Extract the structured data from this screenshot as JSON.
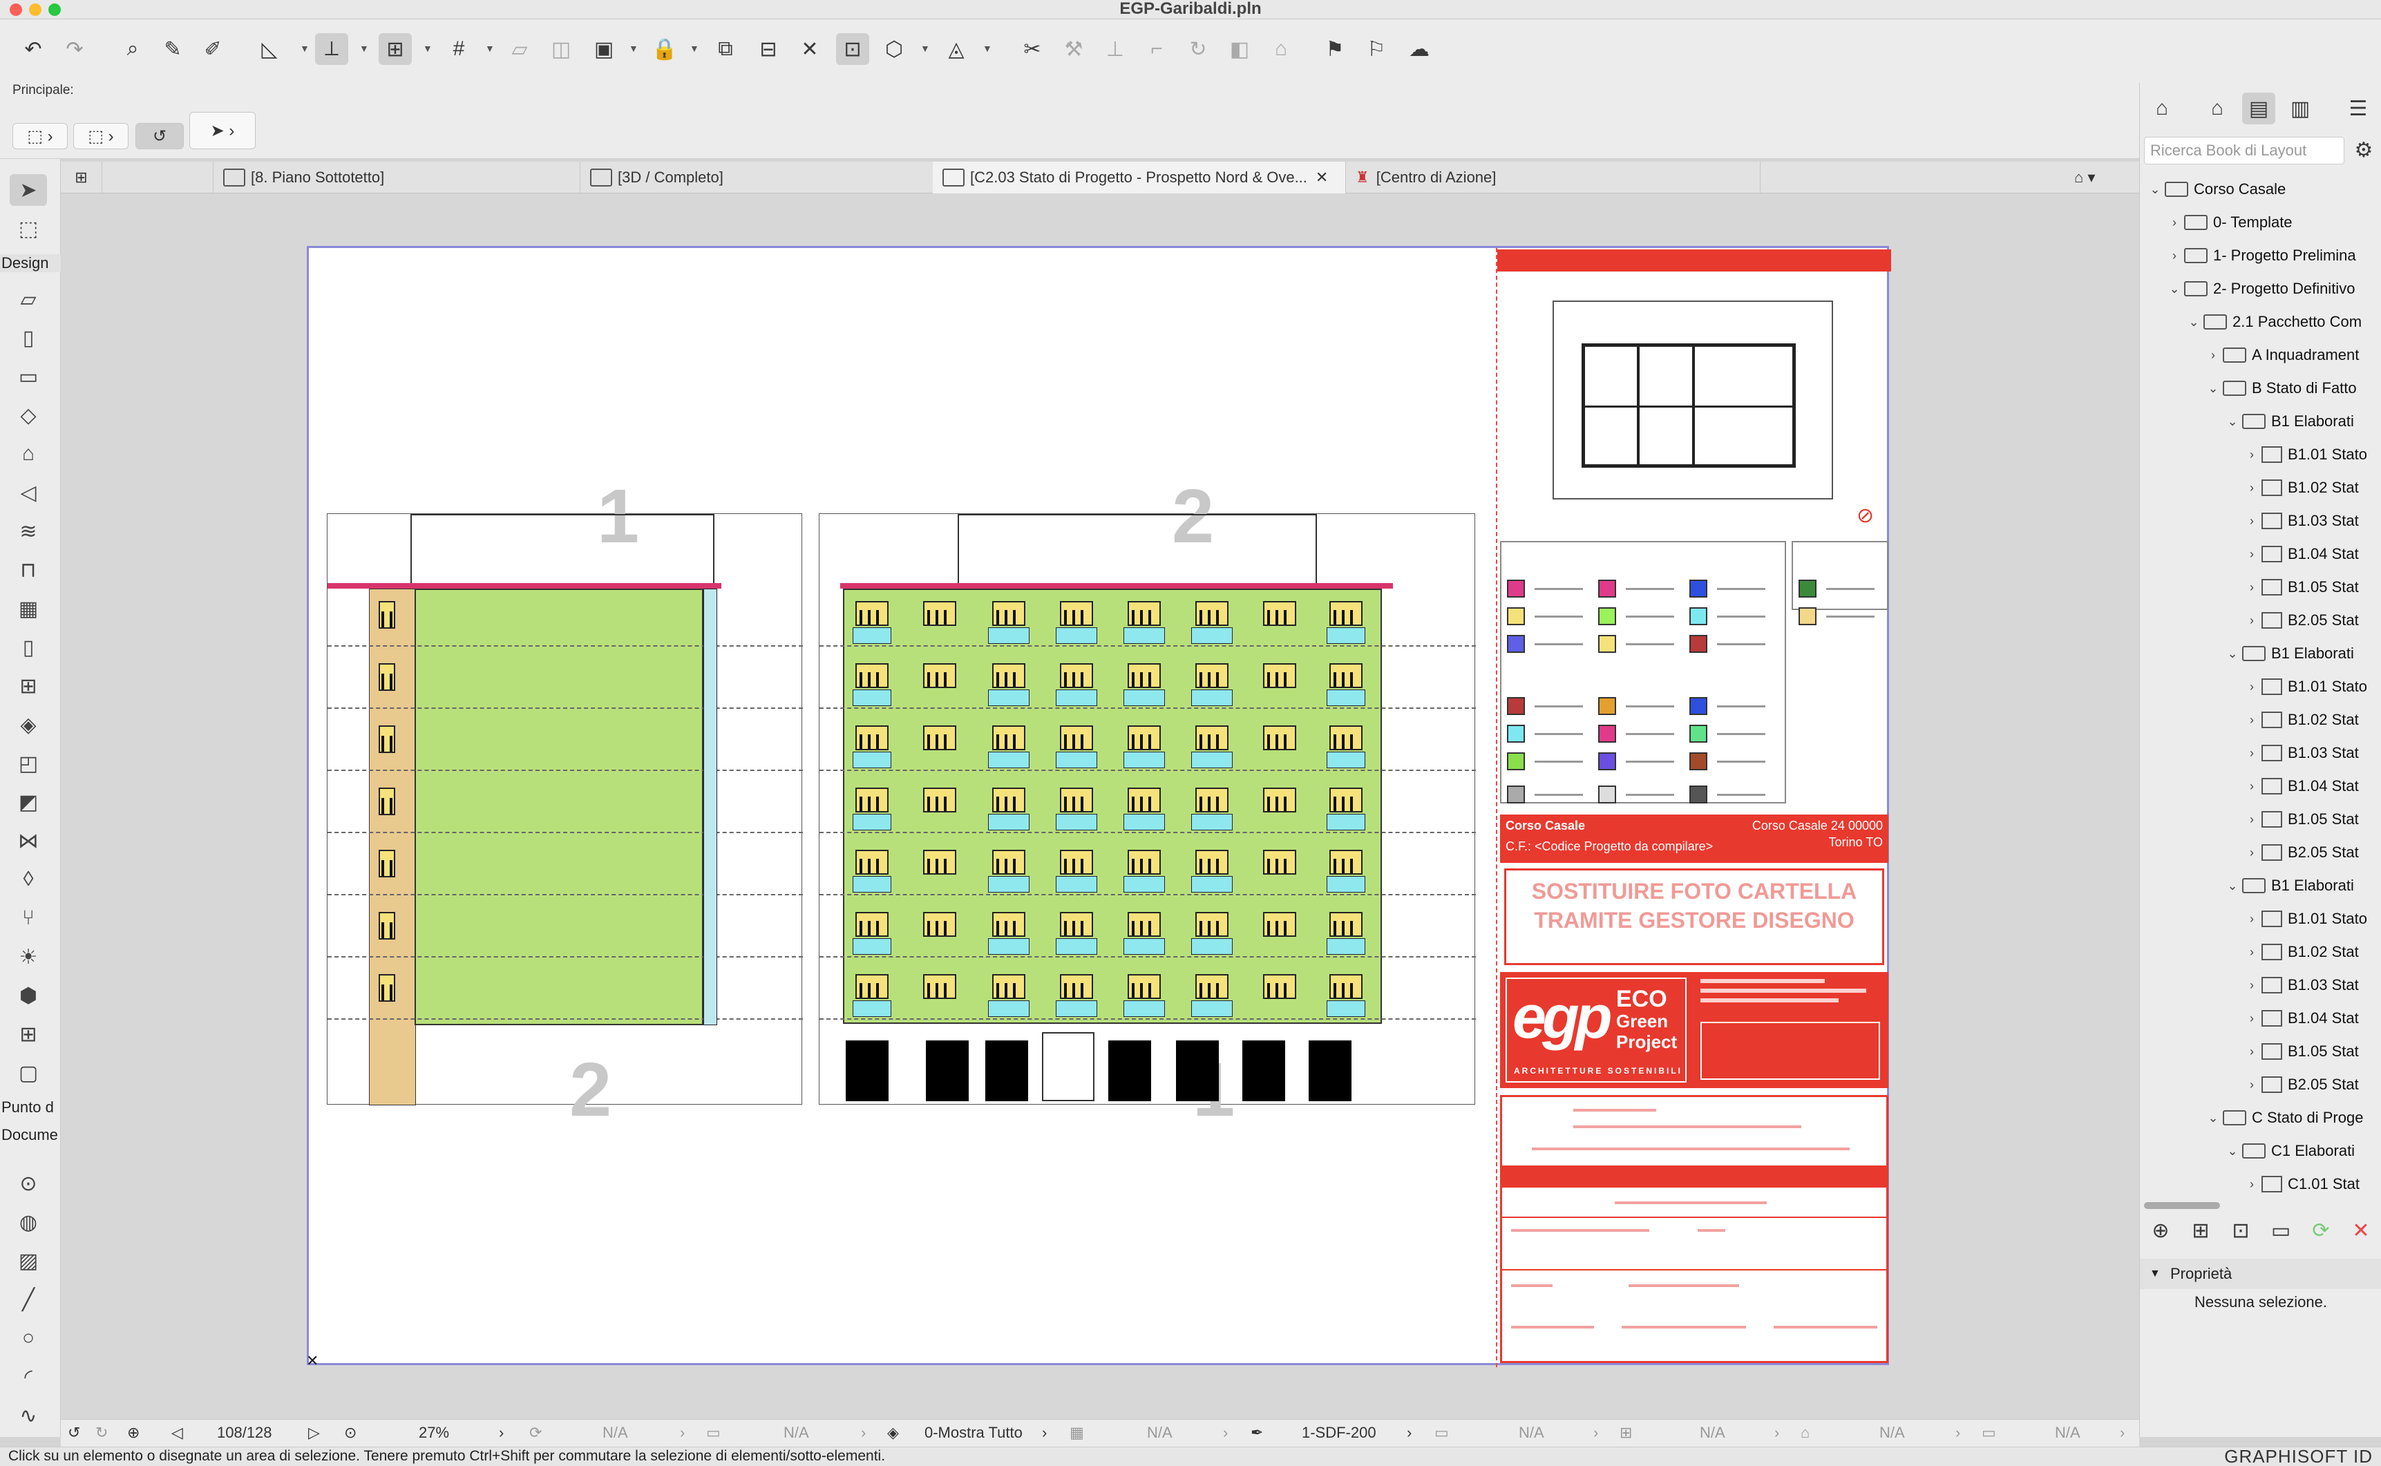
{
  "window": {
    "title": "EGP-Garibaldi.pln"
  },
  "infobar": {
    "label": "Principale:"
  },
  "tabs": [
    {
      "label": "[8. Piano Sottotetto]"
    },
    {
      "label": "[3D / Completo]"
    },
    {
      "label": "[C2.03 Stato di Progetto - Prospetto Nord & Ove..."
    },
    {
      "label": "[Centro di Azione]"
    }
  ],
  "toolbox": {
    "design_label": "Design",
    "punto_label": "Punto d",
    "docume_label": "Docume"
  },
  "titleblock": {
    "project_name": "Corso Casale",
    "project_code": "C.F.: <Codice Progetto da compilare>",
    "address_line1": "Corso Casale 24 00000",
    "address_line2": "Torino TO",
    "photo_line1": "SOSTITUIRE FOTO CARTELLA",
    "photo_line2": "TRAMITE GESTORE DISEGNO",
    "logo_eco": "ECO",
    "logo_green": "Green",
    "logo_project": "Project",
    "logo_tagline": "ARCHITETTURE SOSTENIBILI",
    "logo_mark": "egp"
  },
  "elevations": {
    "left_number_top": "1",
    "left_number_bottom": "2",
    "right_number_top": "2",
    "right_number_bottom": "1"
  },
  "colors": {
    "accent_red": "#e8392e",
    "facade_green": "#b8e07a",
    "balcony_cyan": "#8ee8ee",
    "window_yellow": "#f6e27a",
    "wall_tan": "#e8c98e",
    "roof_magenta": "#d8346c"
  },
  "legend_colors": [
    "#e03a8a",
    "#e03a8a",
    "#2e4fe0",
    "#3a8a3a",
    "#f6e27a",
    "#9cf25a",
    "#7ee8f0",
    "#f3d88a",
    "#5f5fe8",
    "#f6e27a",
    "#b83a3a",
    "#b83a3a",
    "#e3a02e",
    "#2e4fe0",
    "#7ee8f0",
    "#e03a8a",
    "#5fe28a",
    "#8ae04a",
    "#6a4fe0",
    "#a34a2a",
    "#aaaaaa",
    "#dddddd",
    "#555555"
  ],
  "right_panel": {
    "search_placeholder": "Ricerca Book di Layout",
    "tree": [
      {
        "label": "Corso Casale",
        "level": 0,
        "kind": "root",
        "open": true
      },
      {
        "label": "0- Template",
        "level": 1,
        "kind": "folder",
        "open": false
      },
      {
        "label": "1- Progetto Prelimina",
        "level": 1,
        "kind": "folder",
        "open": false
      },
      {
        "label": "2- Progetto Definitivo",
        "level": 1,
        "kind": "folder",
        "open": true
      },
      {
        "label": "2.1 Pacchetto Com",
        "level": 2,
        "kind": "folder",
        "open": true
      },
      {
        "label": "A Inquadrament",
        "level": 3,
        "kind": "folder",
        "open": false
      },
      {
        "label": "B Stato di Fatto",
        "level": 3,
        "kind": "folder",
        "open": true
      },
      {
        "label": "B1 Elaborati",
        "level": 4,
        "kind": "folder",
        "open": true
      },
      {
        "label": "B1.01 Stato",
        "level": 5,
        "kind": "page",
        "open": false
      },
      {
        "label": "B1.02 Stat",
        "level": 5,
        "kind": "page",
        "open": false
      },
      {
        "label": "B1.03 Stat",
        "level": 5,
        "kind": "page",
        "open": false
      },
      {
        "label": "B1.04 Stat",
        "level": 5,
        "kind": "page",
        "open": false
      },
      {
        "label": "B1.05 Stat",
        "level": 5,
        "kind": "page",
        "open": false
      },
      {
        "label": "B2.05 Stat",
        "level": 5,
        "kind": "page",
        "open": false
      },
      {
        "label": "B1 Elaborati",
        "level": 4,
        "kind": "folder",
        "open": true
      },
      {
        "label": "B1.01 Stato",
        "level": 5,
        "kind": "page",
        "open": false
      },
      {
        "label": "B1.02 Stat",
        "level": 5,
        "kind": "page",
        "open": false
      },
      {
        "label": "B1.03 Stat",
        "level": 5,
        "kind": "page",
        "open": false
      },
      {
        "label": "B1.04 Stat",
        "level": 5,
        "kind": "page",
        "open": false
      },
      {
        "label": "B1.05 Stat",
        "level": 5,
        "kind": "page",
        "open": false
      },
      {
        "label": "B2.05 Stat",
        "level": 5,
        "kind": "page",
        "open": false
      },
      {
        "label": "B1 Elaborati",
        "level": 4,
        "kind": "folder",
        "open": true
      },
      {
        "label": "B1.01 Stato",
        "level": 5,
        "kind": "page",
        "open": false
      },
      {
        "label": "B1.02 Stat",
        "level": 5,
        "kind": "page",
        "open": false
      },
      {
        "label": "B1.03 Stat",
        "level": 5,
        "kind": "page",
        "open": false
      },
      {
        "label": "B1.04 Stat",
        "level": 5,
        "kind": "page",
        "open": false
      },
      {
        "label": "B1.05 Stat",
        "level": 5,
        "kind": "page",
        "open": false
      },
      {
        "label": "B2.05 Stat",
        "level": 5,
        "kind": "page",
        "open": false
      },
      {
        "label": "C Stato di Proge",
        "level": 3,
        "kind": "folder",
        "open": true
      },
      {
        "label": "C1 Elaborati",
        "level": 4,
        "kind": "folder",
        "open": true
      },
      {
        "label": "C1.01 Stat",
        "level": 5,
        "kind": "page",
        "open": false
      }
    ],
    "props_title": "Proprietà",
    "props_empty": "Nessuna selezione."
  },
  "navbar": {
    "page": "108/128",
    "zoom": "27%",
    "na1": "N/A",
    "na2": "N/A",
    "layer": "0-Mostra Tutto",
    "na3": "N/A",
    "pen": "1-SDF-200",
    "na4": "N/A",
    "na5": "N/A",
    "na6": "N/A",
    "na7": "N/A"
  },
  "status": {
    "message": "Click su un elemento o disegnate un area di selezione. Tenere premuto Ctrl+Shift per commutare la selezione di elementi/sotto-elementi.",
    "brand": "GRAPHISOFT ID"
  }
}
